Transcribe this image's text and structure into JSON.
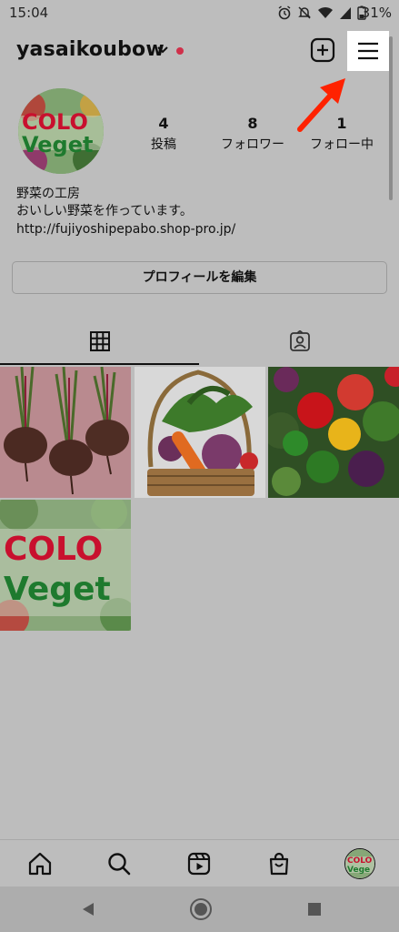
{
  "status_bar": {
    "time": "15:04",
    "battery": "31%"
  },
  "header": {
    "username": "yasaikoubow"
  },
  "profile": {
    "avatar_text_line1": "COLO",
    "avatar_text_line2": "Veget",
    "stats": [
      {
        "value": "4",
        "label": "投稿"
      },
      {
        "value": "8",
        "label": "フォロワー"
      },
      {
        "value": "1",
        "label": "フォロー中"
      }
    ],
    "bio": {
      "name": "野菜の工房",
      "description": "おいしい野菜を作っています。",
      "link": "http://fujiyoshipepabo.shop-pro.jp/"
    },
    "edit_button_label": "プロフィールを編集"
  },
  "tabs": [
    {
      "icon": "grid-icon",
      "active": true
    },
    {
      "icon": "tagged-person-icon",
      "active": false
    }
  ],
  "posts": [
    {
      "subject": "beets",
      "text_line1": "",
      "text_line2": ""
    },
    {
      "subject": "vegetable-basket",
      "text_line1": "",
      "text_line2": ""
    },
    {
      "subject": "assorted-vegetables",
      "text_line1": "",
      "text_line2": ""
    },
    {
      "subject": "colorful-vegetables",
      "text_line1": "COLO",
      "text_line2": "Veget"
    }
  ],
  "bottom_nav": [
    {
      "icon": "home-icon"
    },
    {
      "icon": "search-icon"
    },
    {
      "icon": "reels-icon"
    },
    {
      "icon": "shop-icon"
    },
    {
      "icon": "profile-avatar-icon",
      "text_line1": "COLO",
      "text_line2": "Vege"
    }
  ],
  "colors": {
    "dim_background": "#bdbdbd",
    "highlight": "#ffffff",
    "annotation_arrow": "#ff2200",
    "notification_dot": "#d0304a",
    "brand_red": "#c8102e",
    "brand_green": "#1e7a2e"
  }
}
